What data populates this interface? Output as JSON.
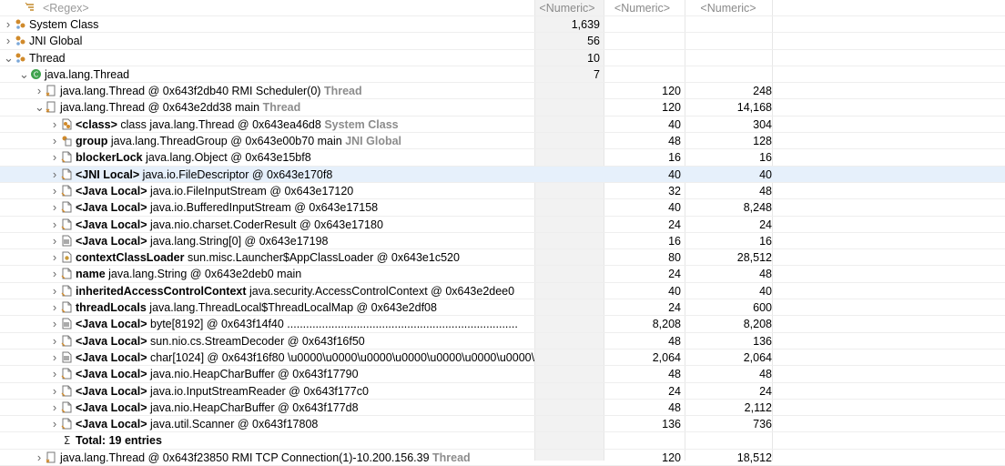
{
  "header": {
    "col0": "<Regex>",
    "col1": "<Numeric>",
    "col2": "<Numeric>",
    "col3": "<Numeric>"
  },
  "rows": [
    {
      "indent": 0,
      "twisty": ">",
      "icon": "class-group",
      "parts": [
        {
          "t": "System Class"
        }
      ],
      "c1": "1,639",
      "c2": "",
      "c3": ""
    },
    {
      "indent": 0,
      "twisty": ">",
      "icon": "class-group",
      "parts": [
        {
          "t": "JNI Global"
        }
      ],
      "c1": "56",
      "c2": "",
      "c3": ""
    },
    {
      "indent": 0,
      "twisty": "v",
      "icon": "class-group",
      "parts": [
        {
          "t": "Thread"
        }
      ],
      "c1": "10",
      "c2": "",
      "c3": ""
    },
    {
      "indent": 1,
      "twisty": "v",
      "icon": "class-c",
      "parts": [
        {
          "t": "java.lang.Thread"
        }
      ],
      "c1": "7",
      "c2": "",
      "c3": ""
    },
    {
      "indent": 2,
      "twisty": ">",
      "icon": "thread",
      "parts": [
        {
          "t": "java.lang.Thread @ 0x643f2db40  RMI Scheduler(0) "
        },
        {
          "t": "Thread",
          "s": "gray"
        }
      ],
      "c1": "",
      "c2": "120",
      "c3": "248"
    },
    {
      "indent": 2,
      "twisty": "v",
      "icon": "thread",
      "parts": [
        {
          "t": "java.lang.Thread @ 0x643e2dd38  main "
        },
        {
          "t": "Thread",
          "s": "gray"
        }
      ],
      "c1": "",
      "c2": "120",
      "c3": "14,168"
    },
    {
      "indent": 3,
      "twisty": ">",
      "icon": "class-obj",
      "parts": [
        {
          "t": "<class>",
          "s": "kw"
        },
        {
          "t": " class java.lang.Thread @ 0x643ea46d8 "
        },
        {
          "t": "System Class",
          "s": "gray"
        }
      ],
      "c1": "",
      "c2": "40",
      "c3": "304"
    },
    {
      "indent": 3,
      "twisty": ">",
      "icon": "group-obj",
      "parts": [
        {
          "t": "group",
          "s": "kw"
        },
        {
          "t": " java.lang.ThreadGroup @ 0x643e00b70  main "
        },
        {
          "t": "JNI Global",
          "s": "gray"
        }
      ],
      "c1": "",
      "c2": "48",
      "c3": "128"
    },
    {
      "indent": 3,
      "twisty": ">",
      "icon": "obj",
      "parts": [
        {
          "t": "blockerLock",
          "s": "kw"
        },
        {
          "t": " java.lang.Object @ 0x643e15bf8"
        }
      ],
      "c1": "",
      "c2": "16",
      "c3": "16"
    },
    {
      "indent": 3,
      "twisty": ">",
      "icon": "obj",
      "selected": true,
      "parts": [
        {
          "t": "<JNI Local>",
          "s": "kw"
        },
        {
          "t": " java.io.FileDescriptor @ 0x643e170f8"
        }
      ],
      "c1": "",
      "c2": "40",
      "c3": "40"
    },
    {
      "indent": 3,
      "twisty": ">",
      "icon": "obj",
      "parts": [
        {
          "t": "<Java Local>",
          "s": "kw"
        },
        {
          "t": " java.io.FileInputStream @ 0x643e17120"
        }
      ],
      "c1": "",
      "c2": "32",
      "c3": "48"
    },
    {
      "indent": 3,
      "twisty": ">",
      "icon": "obj",
      "parts": [
        {
          "t": "<Java Local>",
          "s": "kw"
        },
        {
          "t": " java.io.BufferedInputStream @ 0x643e17158"
        }
      ],
      "c1": "",
      "c2": "40",
      "c3": "8,248"
    },
    {
      "indent": 3,
      "twisty": ">",
      "icon": "obj",
      "parts": [
        {
          "t": "<Java Local>",
          "s": "kw"
        },
        {
          "t": " java.nio.charset.CoderResult @ 0x643e17180"
        }
      ],
      "c1": "",
      "c2": "24",
      "c3": "24"
    },
    {
      "indent": 3,
      "twisty": ">",
      "icon": "array",
      "parts": [
        {
          "t": "<Java Local>",
          "s": "kw"
        },
        {
          "t": " java.lang.String[0] @ 0x643e17198"
        }
      ],
      "c1": "",
      "c2": "16",
      "c3": "16"
    },
    {
      "indent": 3,
      "twisty": ">",
      "icon": "loader",
      "parts": [
        {
          "t": "contextClassLoader",
          "s": "kw"
        },
        {
          "t": " sun.misc.Launcher$AppClassLoader @ 0x643e1c520"
        }
      ],
      "c1": "",
      "c2": "80",
      "c3": "28,512"
    },
    {
      "indent": 3,
      "twisty": ">",
      "icon": "obj",
      "parts": [
        {
          "t": "name",
          "s": "kw"
        },
        {
          "t": " java.lang.String @ 0x643e2deb0  main"
        }
      ],
      "c1": "",
      "c2": "24",
      "c3": "48"
    },
    {
      "indent": 3,
      "twisty": ">",
      "icon": "obj",
      "parts": [
        {
          "t": "inheritedAccessControlContext",
          "s": "kw"
        },
        {
          "t": " java.security.AccessControlContext @ 0x643e2dee0"
        }
      ],
      "c1": "",
      "c2": "40",
      "c3": "40"
    },
    {
      "indent": 3,
      "twisty": ">",
      "icon": "obj",
      "parts": [
        {
          "t": "threadLocals",
          "s": "kw"
        },
        {
          "t": " java.lang.ThreadLocal$ThreadLocalMap @ 0x643e2df08"
        }
      ],
      "c1": "",
      "c2": "24",
      "c3": "600"
    },
    {
      "indent": 3,
      "twisty": ">",
      "icon": "array",
      "parts": [
        {
          "t": "<Java Local>",
          "s": "kw"
        },
        {
          "t": " byte[8192] @ 0x643f14f40  ........................................................................."
        }
      ],
      "c1": "",
      "c2": "8,208",
      "c3": "8,208"
    },
    {
      "indent": 3,
      "twisty": ">",
      "icon": "obj",
      "parts": [
        {
          "t": "<Java Local>",
          "s": "kw"
        },
        {
          "t": " sun.nio.cs.StreamDecoder @ 0x643f16f50"
        }
      ],
      "c1": "",
      "c2": "48",
      "c3": "136"
    },
    {
      "indent": 3,
      "twisty": ">",
      "icon": "array",
      "parts": [
        {
          "t": "<Java Local>",
          "s": "kw"
        },
        {
          "t": " char[1024] @ 0x643f16f80  \\u0000\\u0000\\u0000\\u0000\\u0000\\u0000\\u0000\\u0000"
        }
      ],
      "c1": "",
      "c2": "2,064",
      "c3": "2,064"
    },
    {
      "indent": 3,
      "twisty": ">",
      "icon": "obj",
      "parts": [
        {
          "t": "<Java Local>",
          "s": "kw"
        },
        {
          "t": " java.nio.HeapCharBuffer @ 0x643f17790"
        }
      ],
      "c1": "",
      "c2": "48",
      "c3": "48"
    },
    {
      "indent": 3,
      "twisty": ">",
      "icon": "obj",
      "parts": [
        {
          "t": "<Java Local>",
          "s": "kw"
        },
        {
          "t": " java.io.InputStreamReader @ 0x643f177c0"
        }
      ],
      "c1": "",
      "c2": "24",
      "c3": "24"
    },
    {
      "indent": 3,
      "twisty": ">",
      "icon": "obj",
      "parts": [
        {
          "t": "<Java Local>",
          "s": "kw"
        },
        {
          "t": " java.nio.HeapCharBuffer @ 0x643f177d8"
        }
      ],
      "c1": "",
      "c2": "48",
      "c3": "2,112"
    },
    {
      "indent": 3,
      "twisty": ">",
      "icon": "obj",
      "parts": [
        {
          "t": "<Java Local>",
          "s": "kw"
        },
        {
          "t": " java.util.Scanner @ 0x643f17808"
        }
      ],
      "c1": "",
      "c2": "136",
      "c3": "736"
    },
    {
      "indent": 3,
      "twisty": "",
      "icon": "sigma",
      "parts": [
        {
          "t": "Total: 19 entries",
          "s": "kw"
        }
      ],
      "c1": "",
      "c2": "",
      "c3": ""
    },
    {
      "indent": 2,
      "twisty": ">",
      "icon": "thread",
      "parts": [
        {
          "t": "java.lang.Thread @ 0x643f23850  RMI TCP Connection(1)-10.200.156.39 "
        },
        {
          "t": "Thread",
          "s": "gray"
        }
      ],
      "c1": "",
      "c2": "120",
      "c3": "18,512"
    }
  ]
}
